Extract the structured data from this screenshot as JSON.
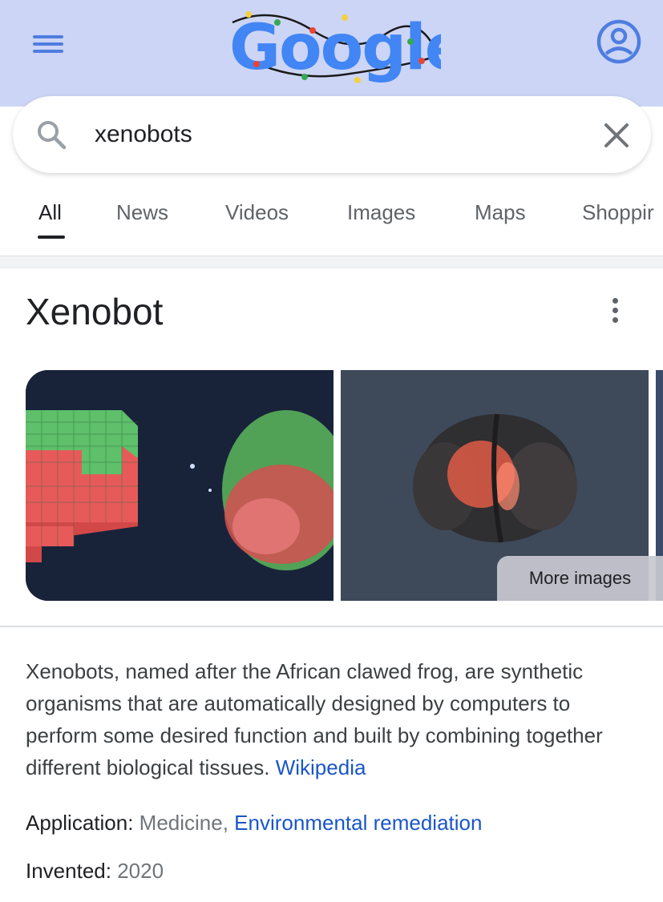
{
  "header": {
    "logo_text": "Google",
    "colors": {
      "background": "#ccd5f5",
      "blue": "#4f7de0"
    }
  },
  "search": {
    "query": "xenobots"
  },
  "tabs": [
    {
      "label": "All",
      "active": true
    },
    {
      "label": "News"
    },
    {
      "label": "Videos"
    },
    {
      "label": "Images"
    },
    {
      "label": "Maps"
    },
    {
      "label": "Shoppir"
    }
  ],
  "knowledge_panel": {
    "title": "Xenobot",
    "more_images_label": "More images",
    "description": "Xenobots, named after the African clawed frog, are synthetic organisms that are automatically designed by computers to perform some desired function and built by combining together different biological tissues.",
    "source_link": "Wikipedia",
    "facts": [
      {
        "label": "Application:",
        "plain_value": "Medicine,",
        "link_value": "Environmental remediation"
      },
      {
        "label": "Invented:",
        "plain_value": "2020"
      }
    ]
  }
}
